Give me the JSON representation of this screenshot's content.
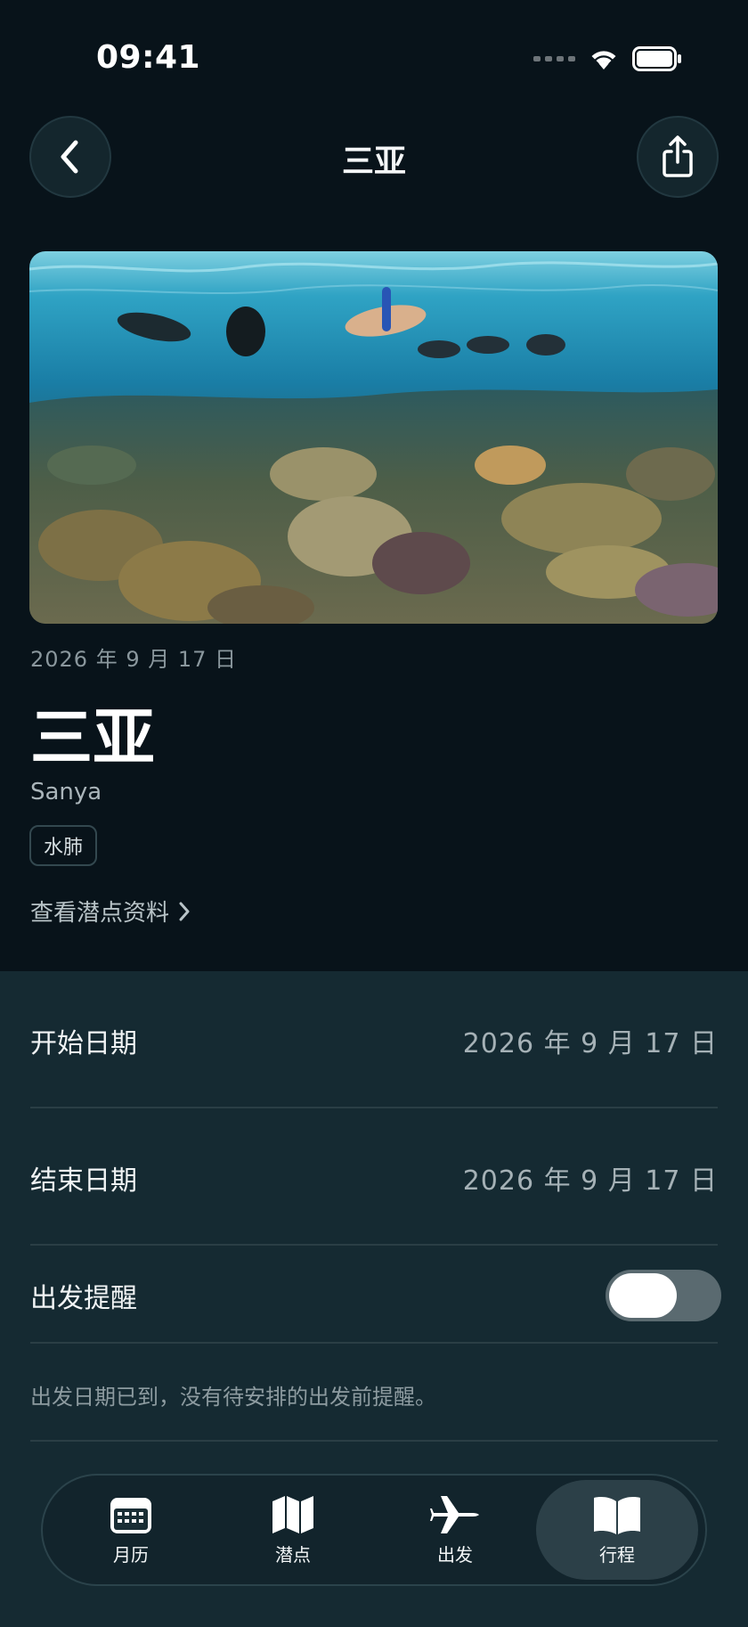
{
  "status_bar": {
    "time": "09:41"
  },
  "nav": {
    "title": "三亚"
  },
  "trip": {
    "date": "2026 年 9 月 17 日",
    "title": "三亚",
    "subtitle": "Sanya",
    "tag": "水肺",
    "link_label": "查看潜点资料"
  },
  "settings": {
    "start_label": "开始日期",
    "start_value": "2026 年 9 月 17 日",
    "end_label": "结束日期",
    "end_value": "2026 年 9 月 17 日",
    "reminder_label": "出发提醒",
    "reminder_on": false,
    "hint": "出发日期已到，没有待安排的出发前提醒。"
  },
  "tabs": [
    {
      "label": "月历",
      "icon": "calendar-icon",
      "active": false
    },
    {
      "label": "潜点",
      "icon": "map-icon",
      "active": false
    },
    {
      "label": "出发",
      "icon": "airplane-icon",
      "active": false
    },
    {
      "label": "行程",
      "icon": "book-icon",
      "active": true
    }
  ],
  "colors": {
    "background": "#08131a",
    "card": "#152a32",
    "accent_water": "#1b7fa6"
  }
}
